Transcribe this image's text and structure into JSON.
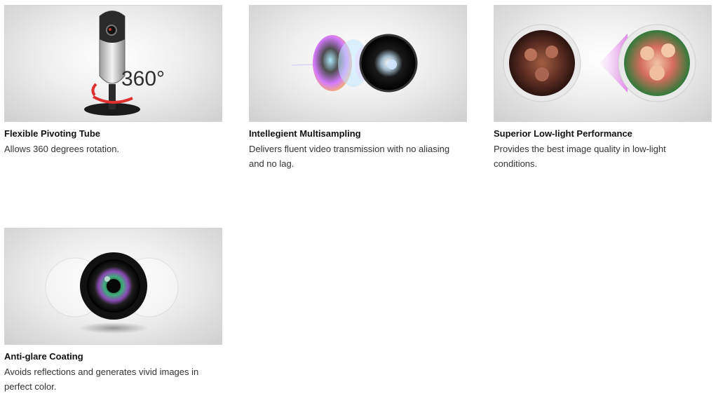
{
  "features": [
    {
      "title": "Flexible Pivoting Tube",
      "description": "Allows 360 degrees rotation.",
      "image_icon": "webcam-rotation-icon",
      "image_text": "360°"
    },
    {
      "title": "Intellegient Multisampling",
      "description": "Delivers fluent video transmission with no aliasing and no lag.",
      "image_icon": "lens-multisampling-icon"
    },
    {
      "title": "Superior Low-light Performance",
      "description": "Provides the best image quality in low-light conditions.",
      "image_icon": "low-light-comparison-icon"
    },
    {
      "title": "Anti-glare Coating",
      "description": "Avoids reflections and generates vivid images in perfect color.",
      "image_icon": "camera-lens-icon"
    }
  ]
}
